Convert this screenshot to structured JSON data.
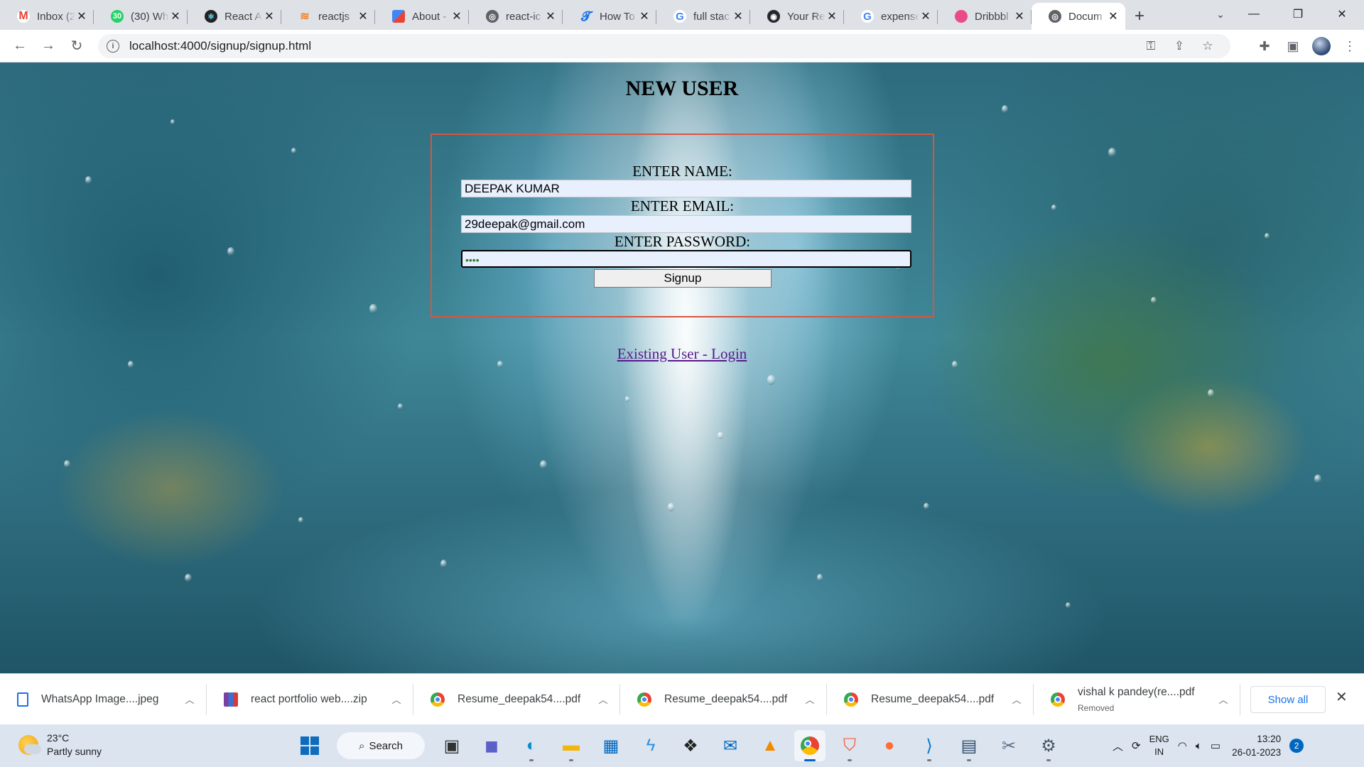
{
  "browser": {
    "tabs": [
      {
        "title": "Inbox (2",
        "favicon": "gmail-icon",
        "color": "#ea4335"
      },
      {
        "title": "(30) Wh",
        "favicon": "whatsapp-icon",
        "color": "#25d366",
        "badge": "30"
      },
      {
        "title": "React A",
        "favicon": "react-icon",
        "color": "#222222"
      },
      {
        "title": "reactjs",
        "favicon": "stackoverflow-icon",
        "color": "#f48024"
      },
      {
        "title": "About -",
        "favicon": "about-icon",
        "color": "#e44d26"
      },
      {
        "title": "react-ic",
        "favicon": "globe-icon",
        "color": "#5f6368"
      },
      {
        "title": "How To",
        "favicon": "howto-icon",
        "color": "#1a73e8"
      },
      {
        "title": "full stac",
        "favicon": "google-icon",
        "color": "#4285f4"
      },
      {
        "title": "Your Re",
        "favicon": "github-icon",
        "color": "#24292f"
      },
      {
        "title": "expense",
        "favicon": "google-icon",
        "color": "#4285f4"
      },
      {
        "title": "Dribbbl",
        "favicon": "dribbble-icon",
        "color": "#ea4c89"
      },
      {
        "title": "Docum",
        "favicon": "globe-icon",
        "color": "#5f6368",
        "active": true
      }
    ],
    "url": "localhost:4000/signup/signup.html"
  },
  "page": {
    "title": "NEW USER",
    "name_label": "ENTER NAME:",
    "name_value": "DEEPAK KUMAR",
    "email_label": "ENTER EMAIL:",
    "email_value": "29deepak@gmail.com",
    "password_label": "ENTER PASSWORD:",
    "password_value": "••••",
    "signup_button": "Signup",
    "login_link": "Existing User - Login"
  },
  "downloads": {
    "items": [
      {
        "name": "WhatsApp Image....jpeg",
        "icon": "file-icon"
      },
      {
        "name": "react portfolio web....zip",
        "icon": "zip-icon"
      },
      {
        "name": "Resume_deepak54....pdf",
        "icon": "chrome-icon"
      },
      {
        "name": "Resume_deepak54....pdf",
        "icon": "chrome-icon"
      },
      {
        "name": "Resume_deepak54....pdf",
        "icon": "chrome-icon"
      },
      {
        "name": "vishal k pandey(re....pdf",
        "icon": "chrome-icon",
        "status": "Removed"
      }
    ],
    "show_all": "Show all"
  },
  "taskbar": {
    "weather_temp": "23°C",
    "weather_desc": "Partly sunny",
    "search_label": "Search",
    "lang_top": "ENG",
    "lang_bottom": "IN",
    "time": "13:20",
    "date": "26-01-2023",
    "notifications": "2"
  }
}
